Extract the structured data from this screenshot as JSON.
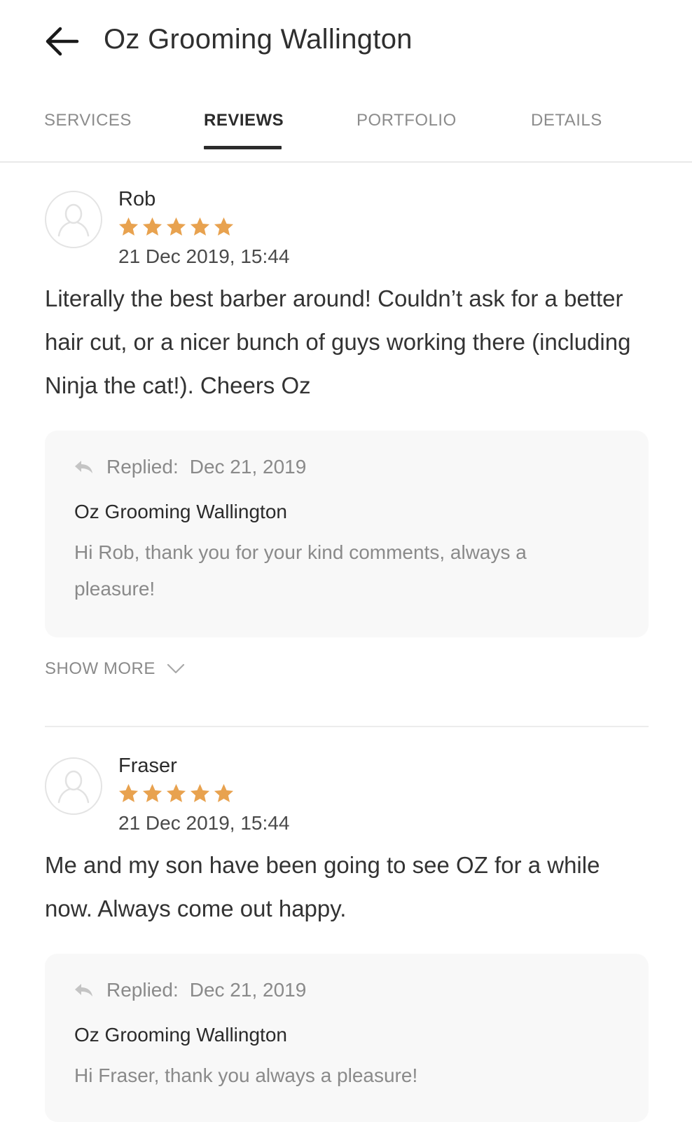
{
  "header": {
    "title": "Oz Grooming Wallington",
    "back_icon": "arrow-left-icon"
  },
  "tabs": [
    {
      "label": "SERVICES",
      "active": false
    },
    {
      "label": "REVIEWS",
      "active": true
    },
    {
      "label": "PORTFOLIO",
      "active": false
    },
    {
      "label": "DETAILS",
      "active": false
    }
  ],
  "colors": {
    "star": "#E8A24F",
    "active_tab": "#2B2B2B",
    "inactive_tab": "#8C8C8C",
    "reply_bg": "#F8F8F8"
  },
  "reviews": [
    {
      "name": "Rob",
      "rating": 5,
      "date": "21 Dec 2019, 15:44",
      "text": "Literally the best barber around! Couldn’t ask for a better hair cut, or a nicer bunch of guys working there (including Ninja the cat!). Cheers Oz",
      "reply": {
        "label": "Replied:",
        "date": "Dec 21, 2019",
        "author": "Oz Grooming Wallington",
        "text": "Hi Rob, thank you for your kind comments, always a pleasure!"
      },
      "show_more": "SHOW MORE"
    },
    {
      "name": "Fraser",
      "rating": 5,
      "date": "21 Dec 2019, 15:44",
      "text": "Me and my son have been going to see OZ for a while now. Always come out happy.",
      "reply": {
        "label": "Replied:",
        "date": "Dec 21, 2019",
        "author": "Oz Grooming Wallington",
        "text": "Hi Fraser, thank you always a pleasure!"
      }
    }
  ]
}
